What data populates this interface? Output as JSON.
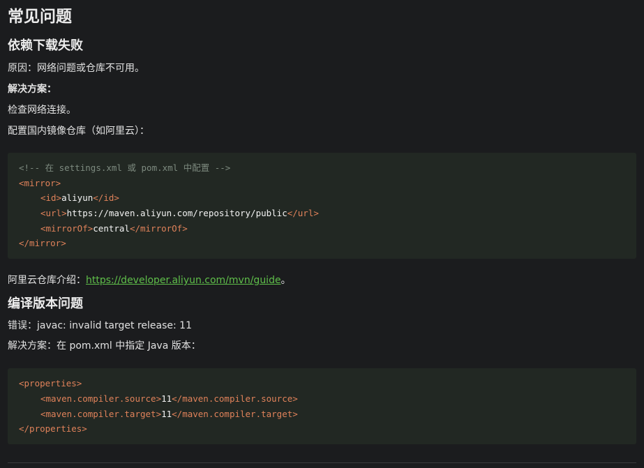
{
  "page_title": "常见问题",
  "section1": {
    "heading": "依赖下载失败",
    "reason": "原因：网络问题或仓库不可用。",
    "solution_label": "解决方案：",
    "step1": "检查网络连接。",
    "step2": "配置国内镜像仓库（如阿里云）：",
    "code": {
      "comment": "<!-- 在 settings.xml 或 pom.xml 中配置 -->",
      "mirror_open": "<mirror>",
      "id_open": "<id>",
      "id_value": "aliyun",
      "id_close": "</id>",
      "url_open": "<url>",
      "url_value": "https://maven.aliyun.com/repository/public",
      "url_close": "</url>",
      "mirrorof_open": "<mirrorOf>",
      "mirrorof_value": "central",
      "mirrorof_close": "</mirrorOf>",
      "mirror_close": "</mirror>"
    },
    "aliyun_intro_prefix": "阿里云仓库介绍：",
    "aliyun_link": "https://developer.aliyun.com/mvn/guide",
    "aliyun_intro_suffix": "。"
  },
  "section2": {
    "heading": "编译版本问题",
    "error": "错误：javac: invalid target release: 11",
    "solution": "解决方案：在 pom.xml 中指定 Java 版本：",
    "code": {
      "props_open": "<properties>",
      "source_open": "<maven.compiler.source>",
      "source_value": "11",
      "source_close": "</maven.compiler.source>",
      "target_open": "<maven.compiler.target>",
      "target_value": "11",
      "target_close": "</maven.compiler.target>",
      "props_close": "</properties>"
    }
  }
}
